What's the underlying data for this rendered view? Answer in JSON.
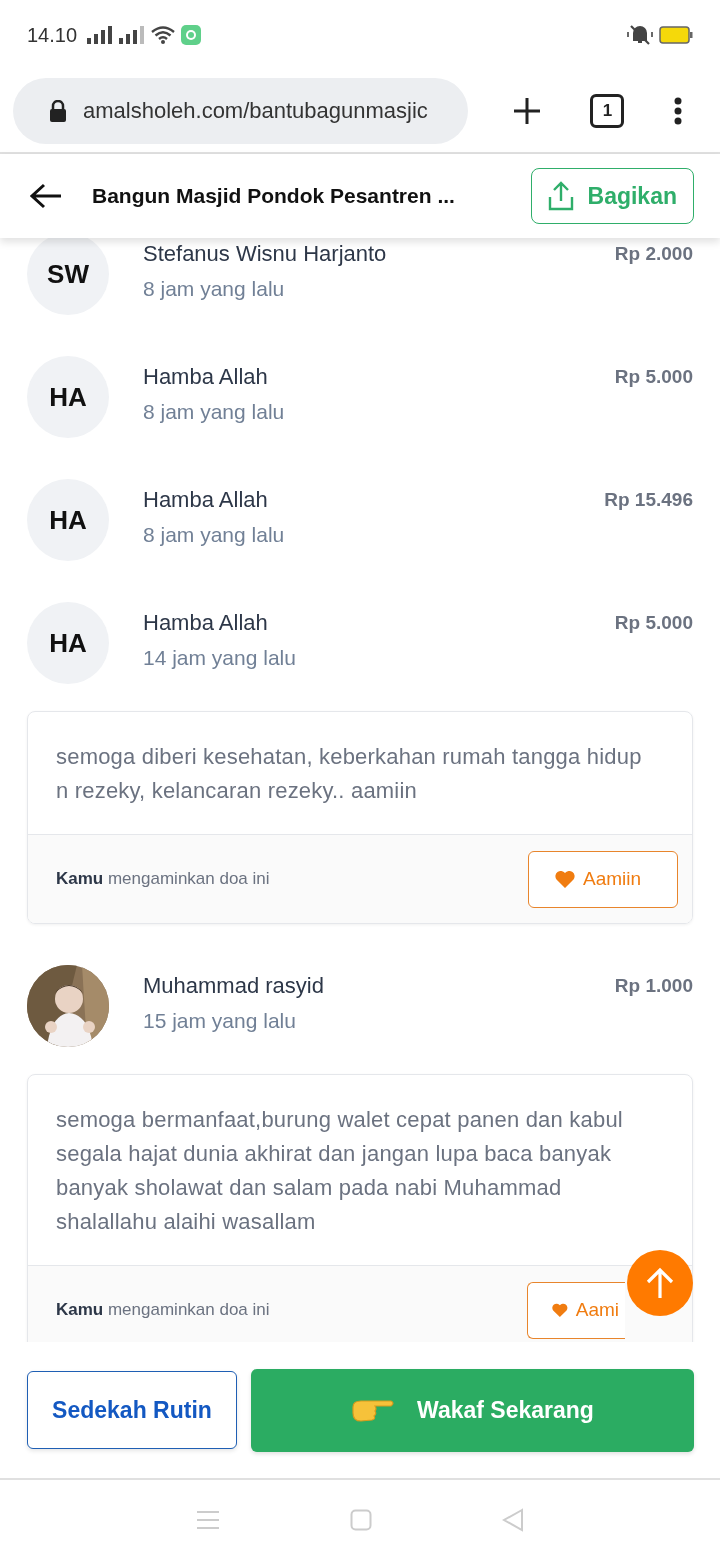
{
  "status_bar": {
    "time": "14.10"
  },
  "browser": {
    "url": "amalsholeh.com/bantubagunmasjic",
    "tab_count": "1"
  },
  "header": {
    "title": "Bangun Masjid Pondok Pesantren ...",
    "share_label": "Bagikan"
  },
  "feed": [
    {
      "kind": "donor",
      "initials": "SW",
      "name": "Stefanus Wisnu Harjanto",
      "time": "8 jam yang lalu",
      "amount": "Rp 2.000"
    },
    {
      "kind": "donor",
      "initials": "HA",
      "name": "Hamba Allah",
      "time": "8 jam yang lalu",
      "amount": "Rp 5.000"
    },
    {
      "kind": "donor",
      "initials": "HA",
      "name": "Hamba Allah",
      "time": "8 jam yang lalu",
      "amount": "Rp 15.496"
    },
    {
      "kind": "donor",
      "initials": "HA",
      "name": "Hamba Allah",
      "time": "14 jam yang lalu",
      "amount": "Rp 5.000"
    },
    {
      "kind": "prayer",
      "text": "semoga diberi kesehatan, keberkahan rumah tangga hidup n rezeky, kelancaran rezeky.. aamiin",
      "amen_note": "**Kamu** mengaminkan doa ini",
      "button": "Aamiin"
    },
    {
      "kind": "donor",
      "name": "Muhammad rasyid",
      "time": "15 jam yang lalu",
      "amount": "Rp 1.000"
    },
    {
      "kind": "prayer",
      "text": "semoga bermanfaat,burung walet cepat panen dan kabul segala hajat dunia akhirat dan jangan lupa baca banyak banyak sholawat dan salam pada nabi Muhammad shalallahu alaihi wasallam",
      "amen_note": "**Kamu** mengaminkan doa ini",
      "button": "Aami"
    }
  ],
  "actions": {
    "secondary": "Sedekah Rutin",
    "primary": "Wakaf Sekarang"
  }
}
